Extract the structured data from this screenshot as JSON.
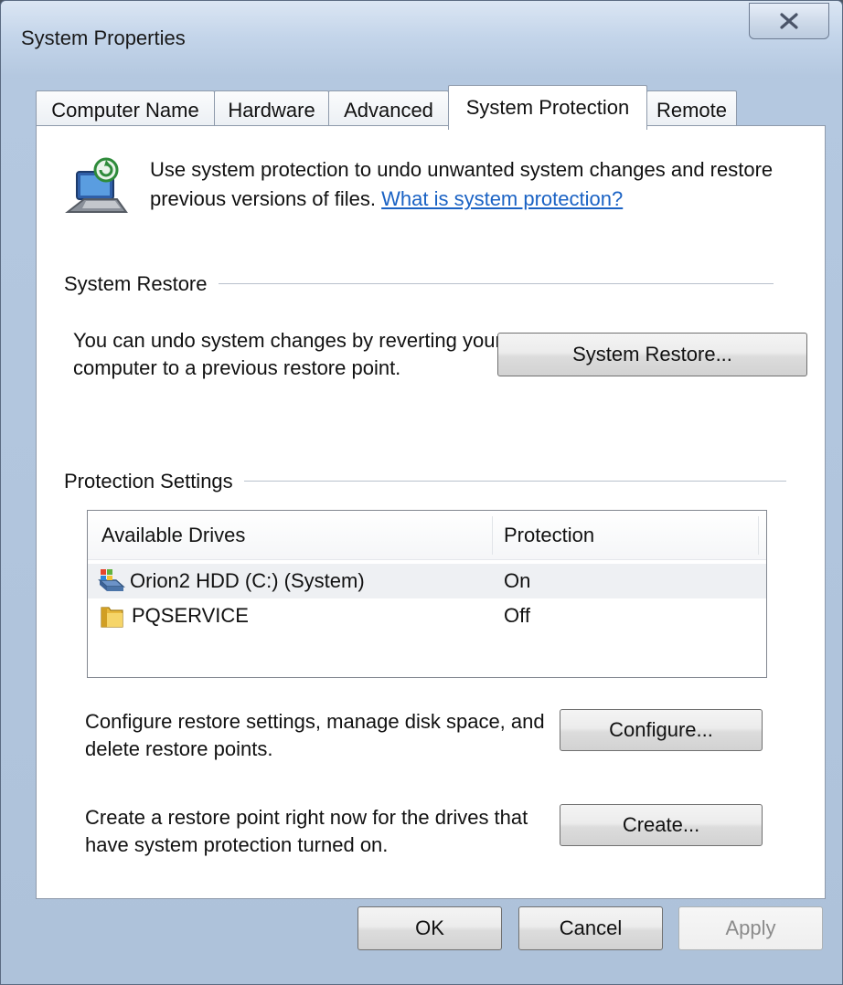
{
  "window": {
    "title": "System Properties"
  },
  "tabs": [
    {
      "label": "Computer Name"
    },
    {
      "label": "Hardware"
    },
    {
      "label": "Advanced"
    },
    {
      "label": "System Protection"
    },
    {
      "label": "Remote"
    }
  ],
  "intro": {
    "text": "Use system protection to undo unwanted system changes and restore previous versions of files.",
    "link": "What is system protection?"
  },
  "system_restore": {
    "group_label": "System Restore",
    "description": "You can undo system changes by reverting your computer to a previous restore point.",
    "button": "System Restore..."
  },
  "protection_settings": {
    "group_label": "Protection Settings",
    "columns": [
      "Available Drives",
      "Protection"
    ],
    "drives": [
      {
        "name": "Orion2 HDD (C:) (System)",
        "protection": "On",
        "icon": "system-drive-icon"
      },
      {
        "name": "PQSERVICE",
        "protection": "Off",
        "icon": "drive-icon"
      }
    ],
    "configure_text": "Configure restore settings, manage disk space, and delete restore points.",
    "configure_button": "Configure...",
    "create_text": "Create a restore point right now for the drives that have system protection turned on.",
    "create_button": "Create..."
  },
  "footer": {
    "ok": "OK",
    "cancel": "Cancel",
    "apply": "Apply"
  },
  "colors": {
    "link": "#1a62c4",
    "titlebar": "#c4d5ea"
  }
}
